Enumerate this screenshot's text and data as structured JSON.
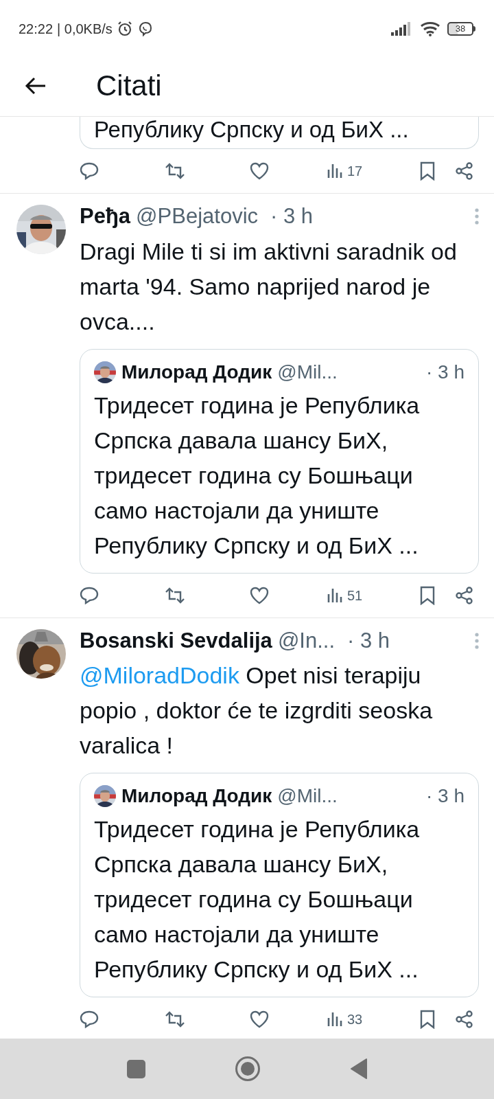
{
  "status_bar": {
    "time": "22:22",
    "speed": "| 0,0KB/s",
    "battery": "38"
  },
  "header": {
    "title": "Citati"
  },
  "top_fragment": {
    "quote_text": "Републику Српску и од БиХ ...",
    "views": "17"
  },
  "tweets": [
    {
      "name": "Peђa",
      "handle": "@PBejatovic",
      "time": "· 3 h",
      "text": "Dragi Mile ti si im aktivni saradnik od marta '94. Samo naprijed narod je ovca....",
      "quote": {
        "name": "Милорад Додик",
        "handle": "@Mil...",
        "time": "· 3 h",
        "text": "Тридесет година је Република Српска давала шансу БиХ, тридесет година су Бошњаци само настојали да униште Републику Српску и од БиХ ..."
      },
      "views": "51"
    },
    {
      "name": "Bosanski Sevdalija",
      "handle": "@In...",
      "time": "· 3 h",
      "mention": "@MiloradDodik",
      "text": "Opet nisi terapiju popio , doktor će te izgrditi seoska varalica !",
      "quote": {
        "name": "Милорад Додик",
        "handle": "@Mil...",
        "time": "· 3 h",
        "text": "Тридесет година је Република Српска давала шансу БиХ, тридесет година су Бошњаци само настојали да униште Републику Српску и од БиХ ..."
      },
      "views": "33"
    }
  ]
}
